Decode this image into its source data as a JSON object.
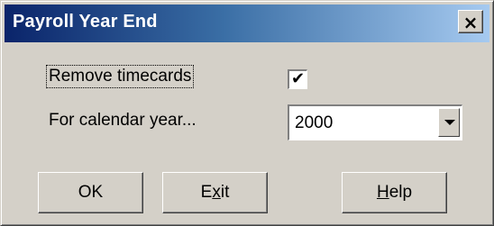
{
  "window": {
    "title": "Payroll Year End",
    "close_symbol": "×"
  },
  "form": {
    "remove_timecards_label": "Remove timecards",
    "remove_timecards_checked": true,
    "checkmark_glyph": "✔",
    "calendar_year_label": "For calendar year...",
    "calendar_year_value": "2000"
  },
  "buttons": {
    "ok_label": "OK",
    "exit_prefix": "E",
    "exit_mnemonic": "x",
    "exit_suffix": "it",
    "help_mnemonic": "H",
    "help_suffix": "elp"
  }
}
